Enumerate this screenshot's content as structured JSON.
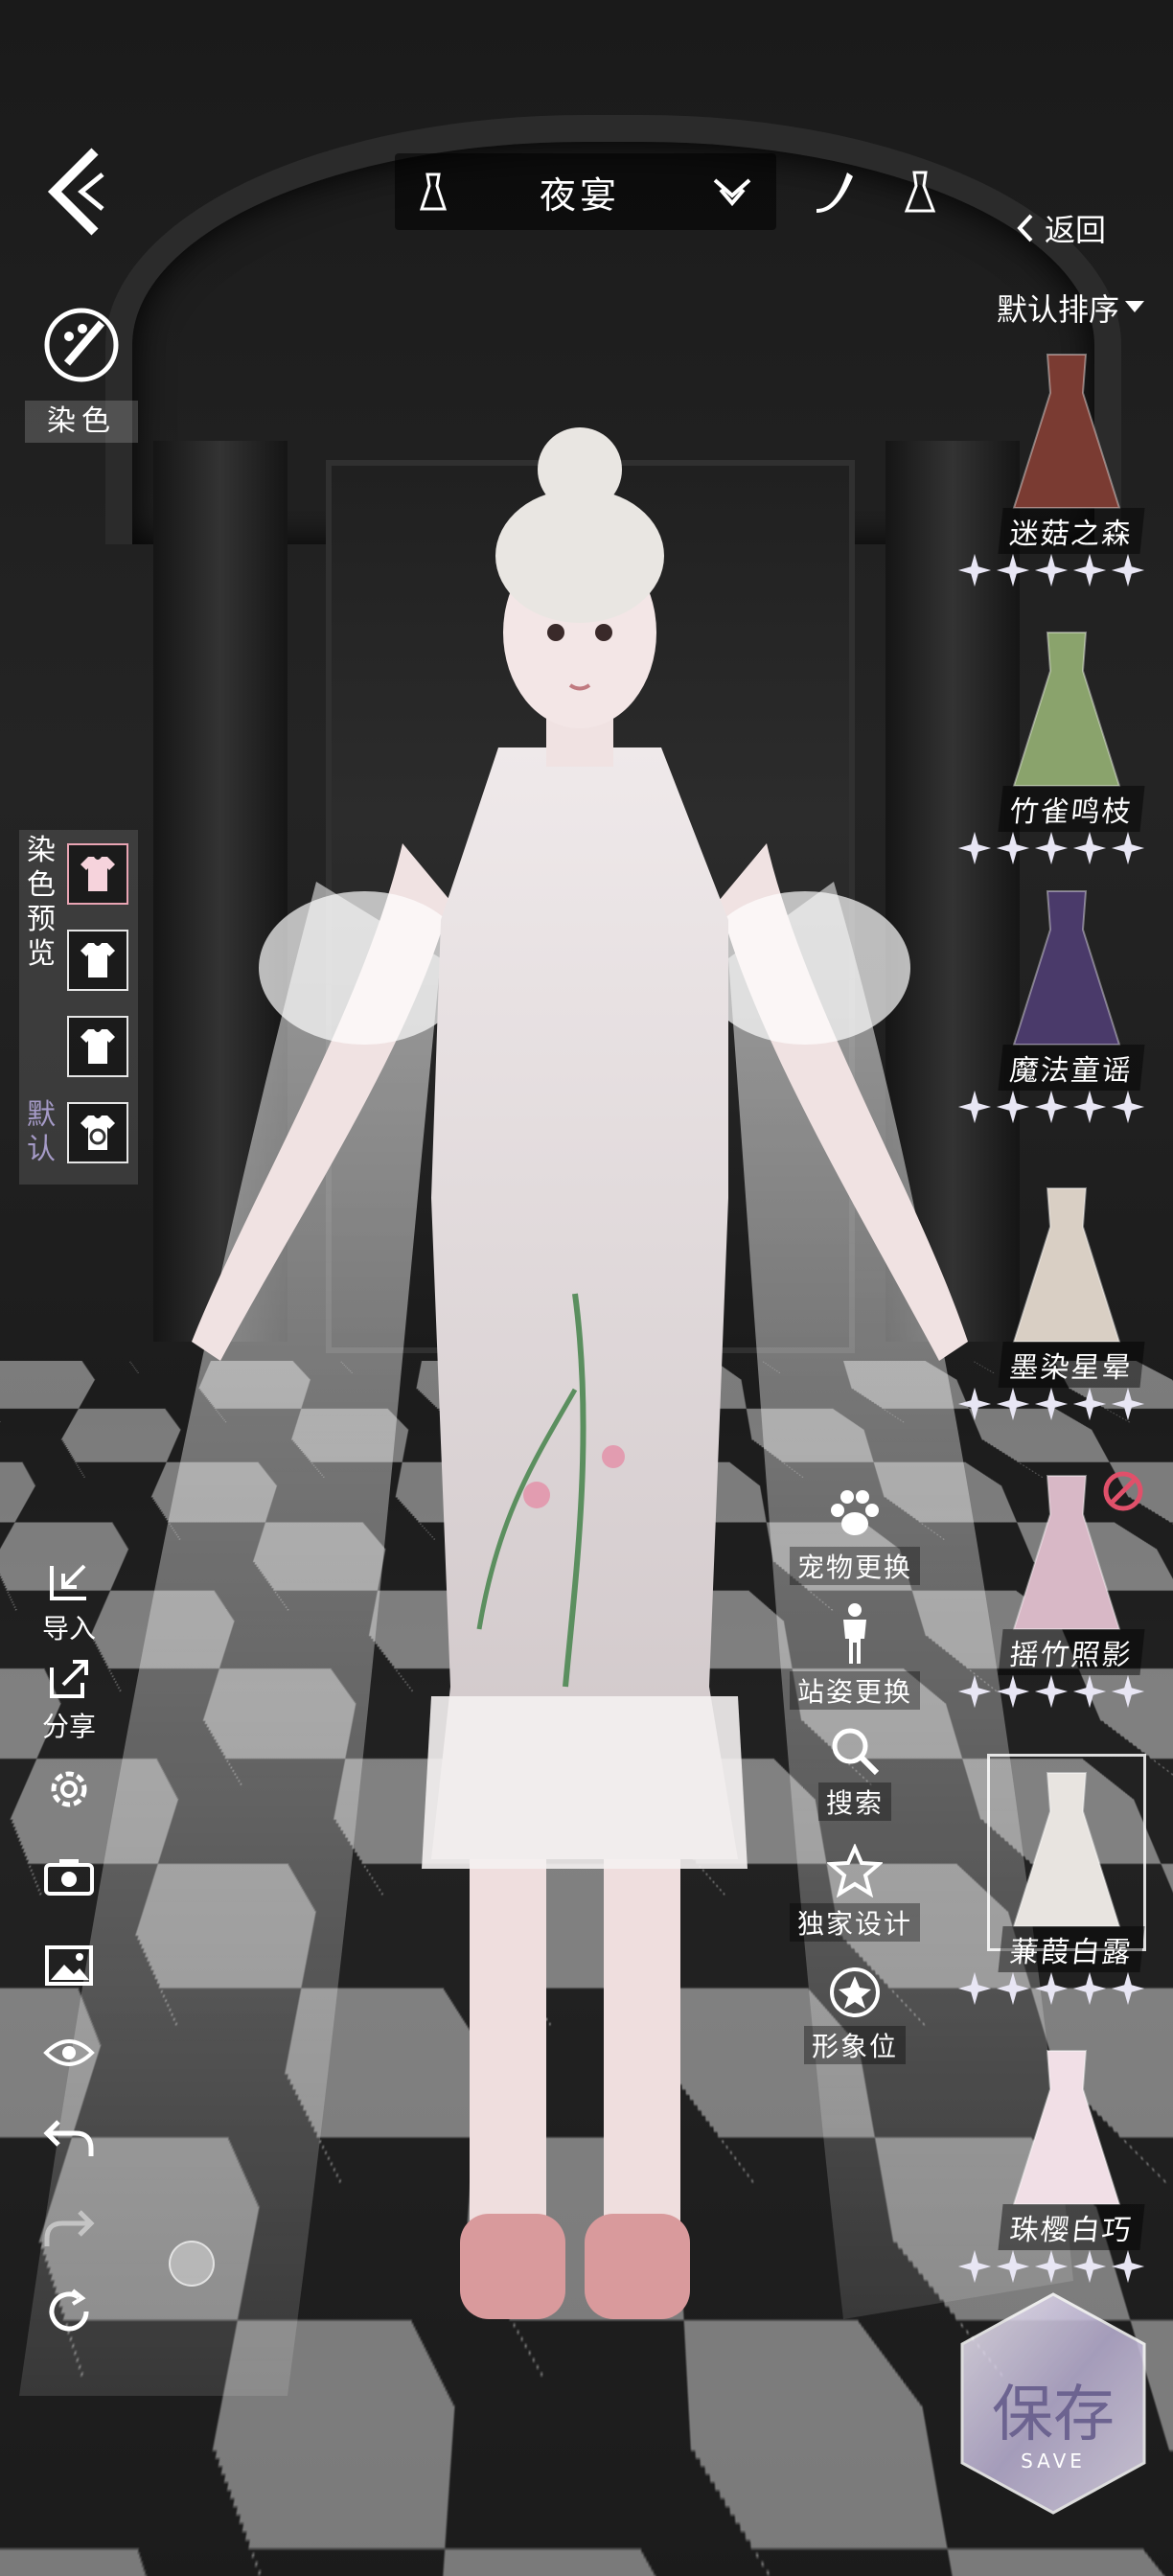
{
  "header": {
    "outfit_category": "夜宴",
    "back_label": "返回",
    "sort_label": "默认排序"
  },
  "dye": {
    "label": "染色"
  },
  "dye_preview": {
    "label": "染色预览",
    "default_label": "默认"
  },
  "left_tools": [
    {
      "label": "导入",
      "icon": "import-icon"
    },
    {
      "label": "分享",
      "icon": "share-icon"
    },
    {
      "label": "",
      "icon": "settings-icon"
    },
    {
      "label": "",
      "icon": "camera-icon"
    },
    {
      "label": "",
      "icon": "image-icon"
    },
    {
      "label": "",
      "icon": "eye-icon"
    },
    {
      "label": "",
      "icon": "undo-icon"
    },
    {
      "label": "",
      "icon": "redo-icon"
    },
    {
      "label": "",
      "icon": "reset-icon"
    }
  ],
  "mid_tools": [
    {
      "label": "宠物更换",
      "icon": "pet-paw-icon"
    },
    {
      "label": "站姿更换",
      "icon": "pose-icon"
    },
    {
      "label": "搜索",
      "icon": "search-icon"
    },
    {
      "label": "独家设计",
      "icon": "star-outline-icon"
    },
    {
      "label": "形象位",
      "icon": "avatar-slot-icon"
    }
  ],
  "outfits": [
    {
      "name": "迷菇之森",
      "stars": 5,
      "color": "#7a3b32"
    },
    {
      "name": "竹雀鸣枝",
      "stars": 5,
      "color": "#8aa36c"
    },
    {
      "name": "魔法童谣",
      "stars": 5,
      "color": "#4a3a6a"
    },
    {
      "name": "墨染星晕",
      "stars": 5,
      "color": "#d9cfc4"
    },
    {
      "name": "摇竹照影",
      "stars": 5,
      "color": "#d8b8c6"
    },
    {
      "name": "蒹葭白露",
      "stars": 5,
      "color": "#e8e4e0",
      "selected": true
    },
    {
      "name": "珠樱白巧",
      "stars": 5,
      "color": "#f1dfe6"
    }
  ],
  "save": {
    "label": "保存",
    "sublabel": "SAVE"
  },
  "colors": {
    "accent_purple": "#a69bc8",
    "star_fill": "#e8e6f4"
  }
}
